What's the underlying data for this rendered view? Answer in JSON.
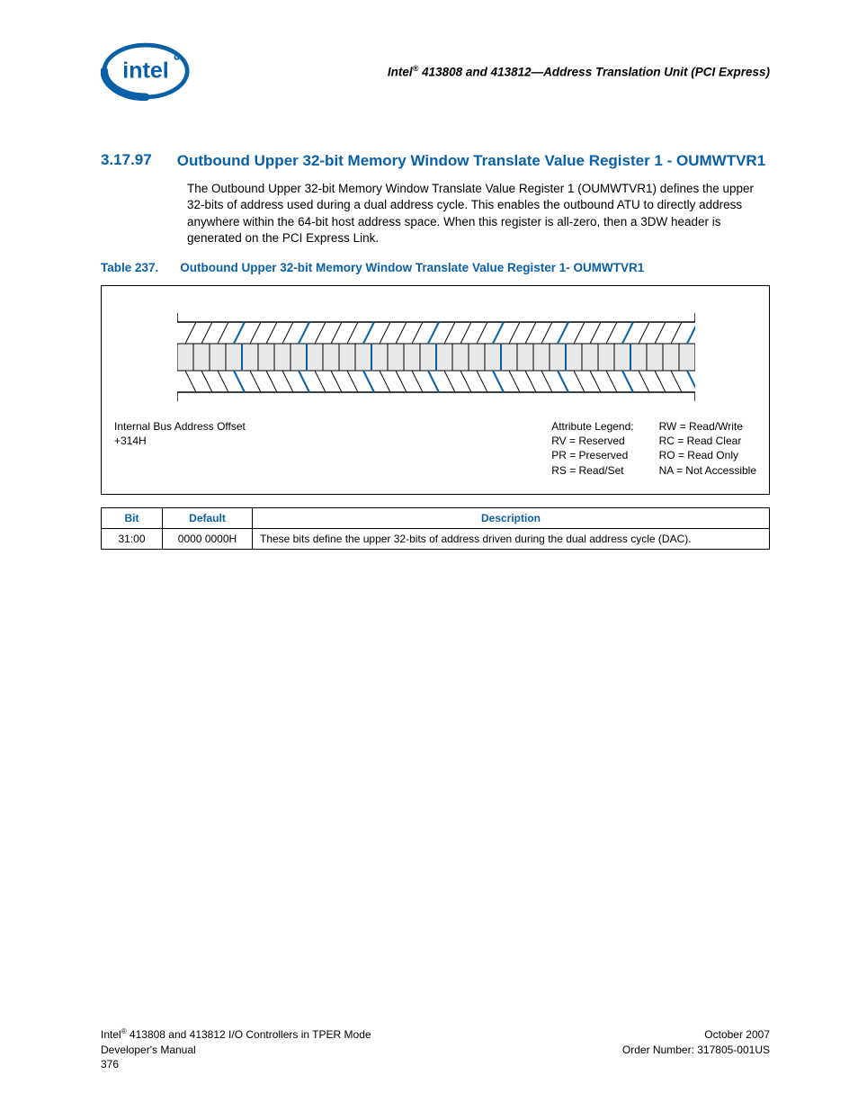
{
  "header": {
    "title_prefix": "Intel",
    "title_suffix": " 413808 and 413812—Address Translation Unit (PCI Express)"
  },
  "section": {
    "number": "3.17.97",
    "title": "Outbound Upper 32-bit Memory Window Translate Value Register 1 - OUMWTVR1"
  },
  "paragraph": "The Outbound Upper 32-bit Memory Window Translate Value Register 1 (OUMWTVR1) defines the upper 32-bits of address used during a dual address cycle. This enables the outbound ATU to directly address anywhere within the 64-bit host address space. When this register is all-zero, then a 3DW header is generated on the PCI Express Link.",
  "table_caption": {
    "label": "Table 237.",
    "title": "Outbound Upper 32-bit Memory Window Translate Value Register 1- OUMWTVR1"
  },
  "offset": {
    "line1": "Internal Bus Address Offset",
    "line2": "+314H"
  },
  "legend": {
    "title": "Attribute Legend:",
    "left": [
      "RV = Reserved",
      "PR = Preserved",
      "RS = Read/Set"
    ],
    "right": [
      "RW = Read/Write",
      "RC = Read Clear",
      "RO = Read Only",
      "NA = Not Accessible"
    ]
  },
  "bits_table": {
    "headers": [
      "Bit",
      "Default",
      "Description"
    ],
    "rows": [
      {
        "bit": "31:00",
        "default": "0000 0000H",
        "description": "These bits define the upper 32-bits of address driven during the dual address cycle (DAC)."
      }
    ]
  },
  "footer": {
    "left_line1_prefix": "Intel",
    "left_line1_suffix": " 413808 and 413812 I/O Controllers in TPER Mode",
    "left_line2": "Developer's Manual",
    "left_line3": "376",
    "right_line1": "October 2007",
    "right_line2": "Order Number: 317805-001US"
  }
}
